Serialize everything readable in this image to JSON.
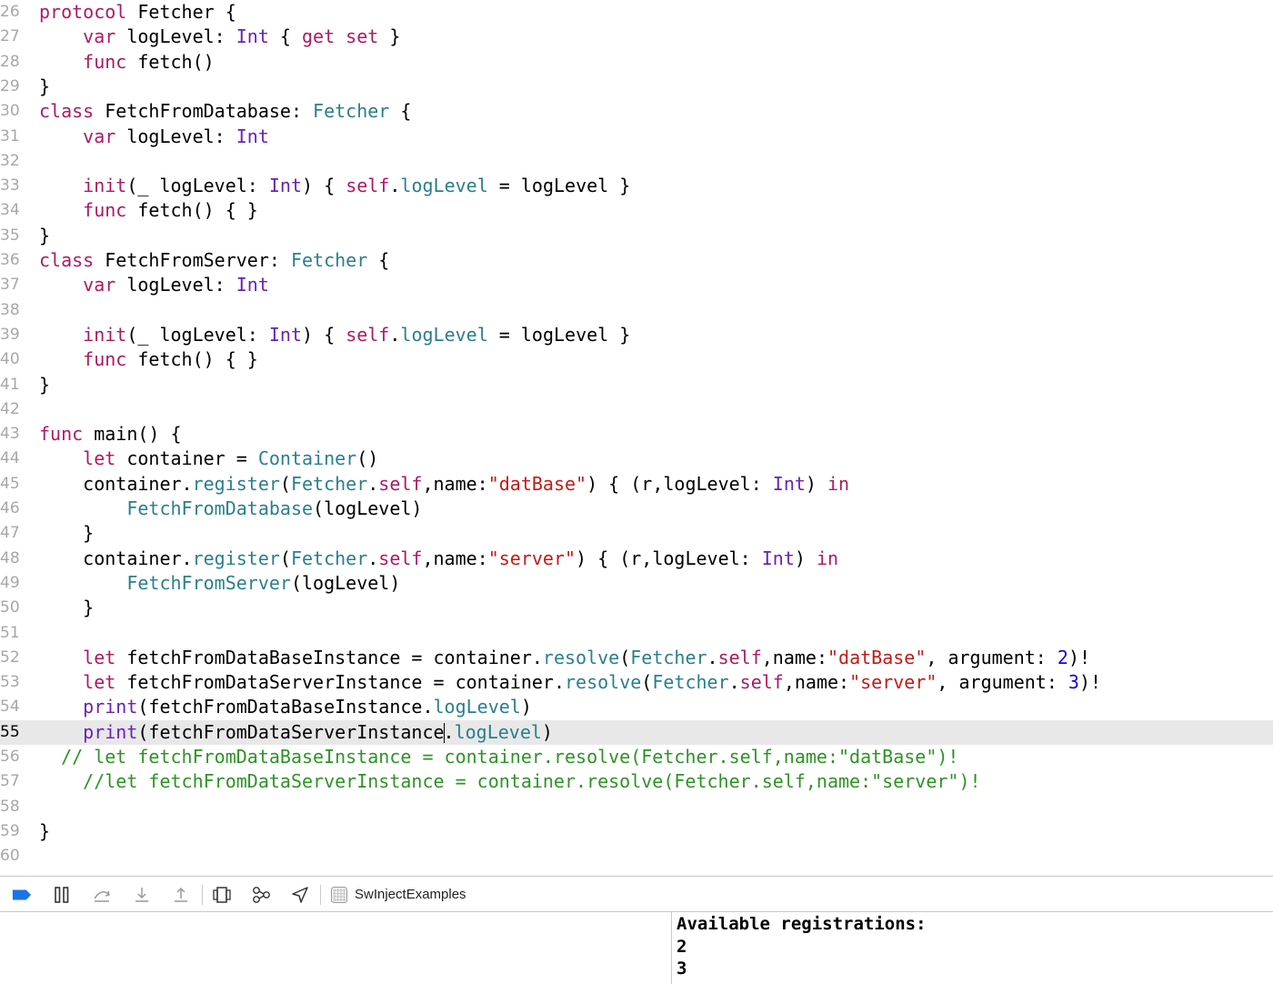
{
  "editor": {
    "current_line": 55,
    "lines": [
      {
        "n": "26",
        "tokens": [
          [
            "kw",
            "protocol"
          ],
          [
            "txt",
            " Fetcher {"
          ]
        ]
      },
      {
        "n": "27",
        "tokens": [
          [
            "txt",
            "    "
          ],
          [
            "kw",
            "var"
          ],
          [
            "txt",
            " logLevel: "
          ],
          [
            "type",
            "Int"
          ],
          [
            "txt",
            " { "
          ],
          [
            "kw",
            "get"
          ],
          [
            "txt",
            " "
          ],
          [
            "kw",
            "set"
          ],
          [
            "txt",
            " }"
          ]
        ]
      },
      {
        "n": "28",
        "tokens": [
          [
            "txt",
            "    "
          ],
          [
            "kw",
            "func"
          ],
          [
            "txt",
            " fetch()"
          ]
        ]
      },
      {
        "n": "29",
        "tokens": [
          [
            "txt",
            "}"
          ]
        ]
      },
      {
        "n": "30",
        "tokens": [
          [
            "kw",
            "class"
          ],
          [
            "txt",
            " FetchFromDatabase: "
          ],
          [
            "cls",
            "Fetcher"
          ],
          [
            "txt",
            " {"
          ]
        ]
      },
      {
        "n": "31",
        "tokens": [
          [
            "txt",
            "    "
          ],
          [
            "kw",
            "var"
          ],
          [
            "txt",
            " logLevel: "
          ],
          [
            "type",
            "Int"
          ]
        ]
      },
      {
        "n": "32",
        "tokens": []
      },
      {
        "n": "33",
        "tokens": [
          [
            "txt",
            "    "
          ],
          [
            "kw",
            "init"
          ],
          [
            "txt",
            "(_ logLevel: "
          ],
          [
            "type",
            "Int"
          ],
          [
            "txt",
            ") { "
          ],
          [
            "kw",
            "self"
          ],
          [
            "txt",
            "."
          ],
          [
            "cls",
            "logLevel"
          ],
          [
            "txt",
            " = logLevel }"
          ]
        ]
      },
      {
        "n": "34",
        "tokens": [
          [
            "txt",
            "    "
          ],
          [
            "kw",
            "func"
          ],
          [
            "txt",
            " fetch() { }"
          ]
        ]
      },
      {
        "n": "35",
        "tokens": [
          [
            "txt",
            "}"
          ]
        ]
      },
      {
        "n": "36",
        "tokens": [
          [
            "kw",
            "class"
          ],
          [
            "txt",
            " FetchFromServer: "
          ],
          [
            "cls",
            "Fetcher"
          ],
          [
            "txt",
            " {"
          ]
        ]
      },
      {
        "n": "37",
        "tokens": [
          [
            "txt",
            "    "
          ],
          [
            "kw",
            "var"
          ],
          [
            "txt",
            " logLevel: "
          ],
          [
            "type",
            "Int"
          ]
        ]
      },
      {
        "n": "38",
        "tokens": []
      },
      {
        "n": "39",
        "tokens": [
          [
            "txt",
            "    "
          ],
          [
            "kw",
            "init"
          ],
          [
            "txt",
            "(_ logLevel: "
          ],
          [
            "type",
            "Int"
          ],
          [
            "txt",
            ") { "
          ],
          [
            "kw",
            "self"
          ],
          [
            "txt",
            "."
          ],
          [
            "cls",
            "logLevel"
          ],
          [
            "txt",
            " = logLevel }"
          ]
        ]
      },
      {
        "n": "40",
        "tokens": [
          [
            "txt",
            "    "
          ],
          [
            "kw",
            "func"
          ],
          [
            "txt",
            " fetch() { }"
          ]
        ]
      },
      {
        "n": "41",
        "tokens": [
          [
            "txt",
            "}"
          ]
        ]
      },
      {
        "n": "42",
        "tokens": []
      },
      {
        "n": "43",
        "tokens": [
          [
            "kw",
            "func"
          ],
          [
            "txt",
            " main() {"
          ]
        ]
      },
      {
        "n": "44",
        "tokens": [
          [
            "txt",
            "    "
          ],
          [
            "kw",
            "let"
          ],
          [
            "txt",
            " container = "
          ],
          [
            "cls",
            "Container"
          ],
          [
            "txt",
            "()"
          ]
        ]
      },
      {
        "n": "45",
        "tokens": [
          [
            "txt",
            "    container."
          ],
          [
            "cls",
            "register"
          ],
          [
            "txt",
            "("
          ],
          [
            "cls",
            "Fetcher"
          ],
          [
            "txt",
            "."
          ],
          [
            "kw",
            "self"
          ],
          [
            "txt",
            ",name:"
          ],
          [
            "str",
            "\"datBase\""
          ],
          [
            "txt",
            ") { (r,logLevel: "
          ],
          [
            "type",
            "Int"
          ],
          [
            "txt",
            ") "
          ],
          [
            "kw",
            "in"
          ]
        ]
      },
      {
        "n": "46",
        "tokens": [
          [
            "txt",
            "        "
          ],
          [
            "cls",
            "FetchFromDatabase"
          ],
          [
            "txt",
            "(logLevel)"
          ]
        ]
      },
      {
        "n": "47",
        "tokens": [
          [
            "txt",
            "    }"
          ]
        ]
      },
      {
        "n": "48",
        "tokens": [
          [
            "txt",
            "    container."
          ],
          [
            "cls",
            "register"
          ],
          [
            "txt",
            "("
          ],
          [
            "cls",
            "Fetcher"
          ],
          [
            "txt",
            "."
          ],
          [
            "kw",
            "self"
          ],
          [
            "txt",
            ",name:"
          ],
          [
            "str",
            "\"server\""
          ],
          [
            "txt",
            ") { (r,logLevel: "
          ],
          [
            "type",
            "Int"
          ],
          [
            "txt",
            ") "
          ],
          [
            "kw",
            "in"
          ]
        ]
      },
      {
        "n": "49",
        "tokens": [
          [
            "txt",
            "        "
          ],
          [
            "cls",
            "FetchFromServer"
          ],
          [
            "txt",
            "(logLevel)"
          ]
        ]
      },
      {
        "n": "50",
        "tokens": [
          [
            "txt",
            "    }"
          ]
        ]
      },
      {
        "n": "51",
        "tokens": []
      },
      {
        "n": "52",
        "tokens": [
          [
            "txt",
            "    "
          ],
          [
            "kw",
            "let"
          ],
          [
            "txt",
            " fetchFromDataBaseInstance = container."
          ],
          [
            "cls",
            "resolve"
          ],
          [
            "txt",
            "("
          ],
          [
            "cls",
            "Fetcher"
          ],
          [
            "txt",
            "."
          ],
          [
            "kw",
            "self"
          ],
          [
            "txt",
            ",name:"
          ],
          [
            "str",
            "\"datBase\""
          ],
          [
            "txt",
            ", argument: "
          ],
          [
            "num",
            "2"
          ],
          [
            "txt",
            ")!"
          ]
        ]
      },
      {
        "n": "53",
        "tokens": [
          [
            "txt",
            "    "
          ],
          [
            "kw",
            "let"
          ],
          [
            "txt",
            " fetchFromDataServerInstance = container."
          ],
          [
            "cls",
            "resolve"
          ],
          [
            "txt",
            "("
          ],
          [
            "cls",
            "Fetcher"
          ],
          [
            "txt",
            "."
          ],
          [
            "kw",
            "self"
          ],
          [
            "txt",
            ",name:"
          ],
          [
            "str",
            "\"server\""
          ],
          [
            "txt",
            ", argument: "
          ],
          [
            "num",
            "3"
          ],
          [
            "txt",
            ")!"
          ]
        ]
      },
      {
        "n": "54",
        "tokens": [
          [
            "txt",
            "    "
          ],
          [
            "type",
            "print"
          ],
          [
            "txt",
            "(fetchFromDataBaseInstance."
          ],
          [
            "cls",
            "logLevel"
          ],
          [
            "txt",
            ")"
          ]
        ]
      },
      {
        "n": "55",
        "tokens": [
          [
            "txt",
            "    "
          ],
          [
            "type",
            "print"
          ],
          [
            "txt",
            "(fetchFromDataServerInstance"
          ],
          [
            "caret",
            ""
          ],
          [
            "txt",
            "."
          ],
          [
            "cls",
            "logLevel"
          ],
          [
            "txt",
            ")"
          ]
        ]
      },
      {
        "n": "56",
        "tokens": [
          [
            "txt",
            "  "
          ],
          [
            "cm",
            "// let fetchFromDataBaseInstance = container.resolve(Fetcher.self,name:\"datBase\")!"
          ]
        ]
      },
      {
        "n": "57",
        "tokens": [
          [
            "txt",
            "    "
          ],
          [
            "cm",
            "//let fetchFromDataServerInstance = container.resolve(Fetcher.self,name:\"server\")!"
          ]
        ]
      },
      {
        "n": "58",
        "tokens": []
      },
      {
        "n": "59",
        "tokens": [
          [
            "txt",
            "}"
          ]
        ]
      },
      {
        "n": "60",
        "tokens": []
      }
    ]
  },
  "debug_bar": {
    "buttons": [
      {
        "name": "breakpoints-toggle-button",
        "icon": "breakpoint-icon"
      },
      {
        "name": "pause-continue-button",
        "icon": "pause-icon"
      },
      {
        "name": "step-over-button",
        "icon": "step-over-icon"
      },
      {
        "name": "step-into-button",
        "icon": "step-into-icon"
      },
      {
        "name": "step-out-button",
        "icon": "step-out-icon"
      },
      {
        "name": "debug-view-hierarchy-button",
        "icon": "view-hierarchy-icon"
      },
      {
        "name": "debug-memory-graph-button",
        "icon": "memory-graph-icon"
      },
      {
        "name": "simulate-location-button",
        "icon": "location-arrow-icon"
      }
    ],
    "target_name": "SwInjectExamples",
    "accent_color": "#1a73e8"
  },
  "console": {
    "lines": [
      "Available registrations:",
      "2",
      "3"
    ]
  }
}
